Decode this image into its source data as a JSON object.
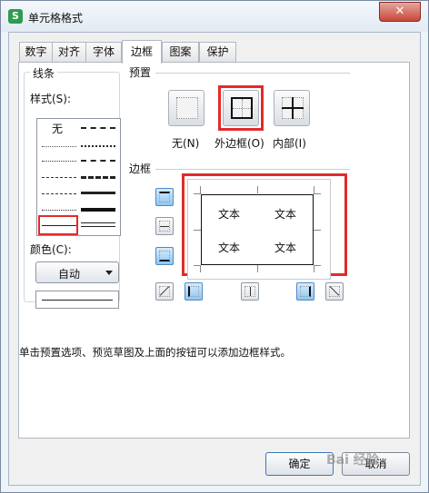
{
  "window": {
    "title": "单元格格式",
    "close_glyph": "✕",
    "app_icon_letter": "S"
  },
  "tabs": [
    {
      "label": "数字"
    },
    {
      "label": "对齐"
    },
    {
      "label": "字体"
    },
    {
      "label": "边框"
    },
    {
      "label": "图案"
    },
    {
      "label": "保护"
    }
  ],
  "line_group": {
    "title": "线条",
    "style_label": "样式(S):",
    "none_label": "无",
    "color_label": "颜色(C):",
    "color_value": "自动"
  },
  "presets": {
    "title": "预置",
    "items": [
      {
        "label": "无(N)"
      },
      {
        "label": "外边框(O)"
      },
      {
        "label": "内部(I)"
      }
    ]
  },
  "border": {
    "title": "边框",
    "preview_texts": [
      "文本",
      "文本",
      "文本",
      "文本"
    ]
  },
  "hint": "单击预置选项、预览草图及上面的按钮可以添加边框样式。",
  "buttons": {
    "ok": "确定",
    "cancel": "取消"
  },
  "watermark": "Bai 经验",
  "colors": {
    "highlight": "#e12b2b",
    "toggle_on": "#8ec7f4",
    "app_icon": "#2e9c4f"
  }
}
